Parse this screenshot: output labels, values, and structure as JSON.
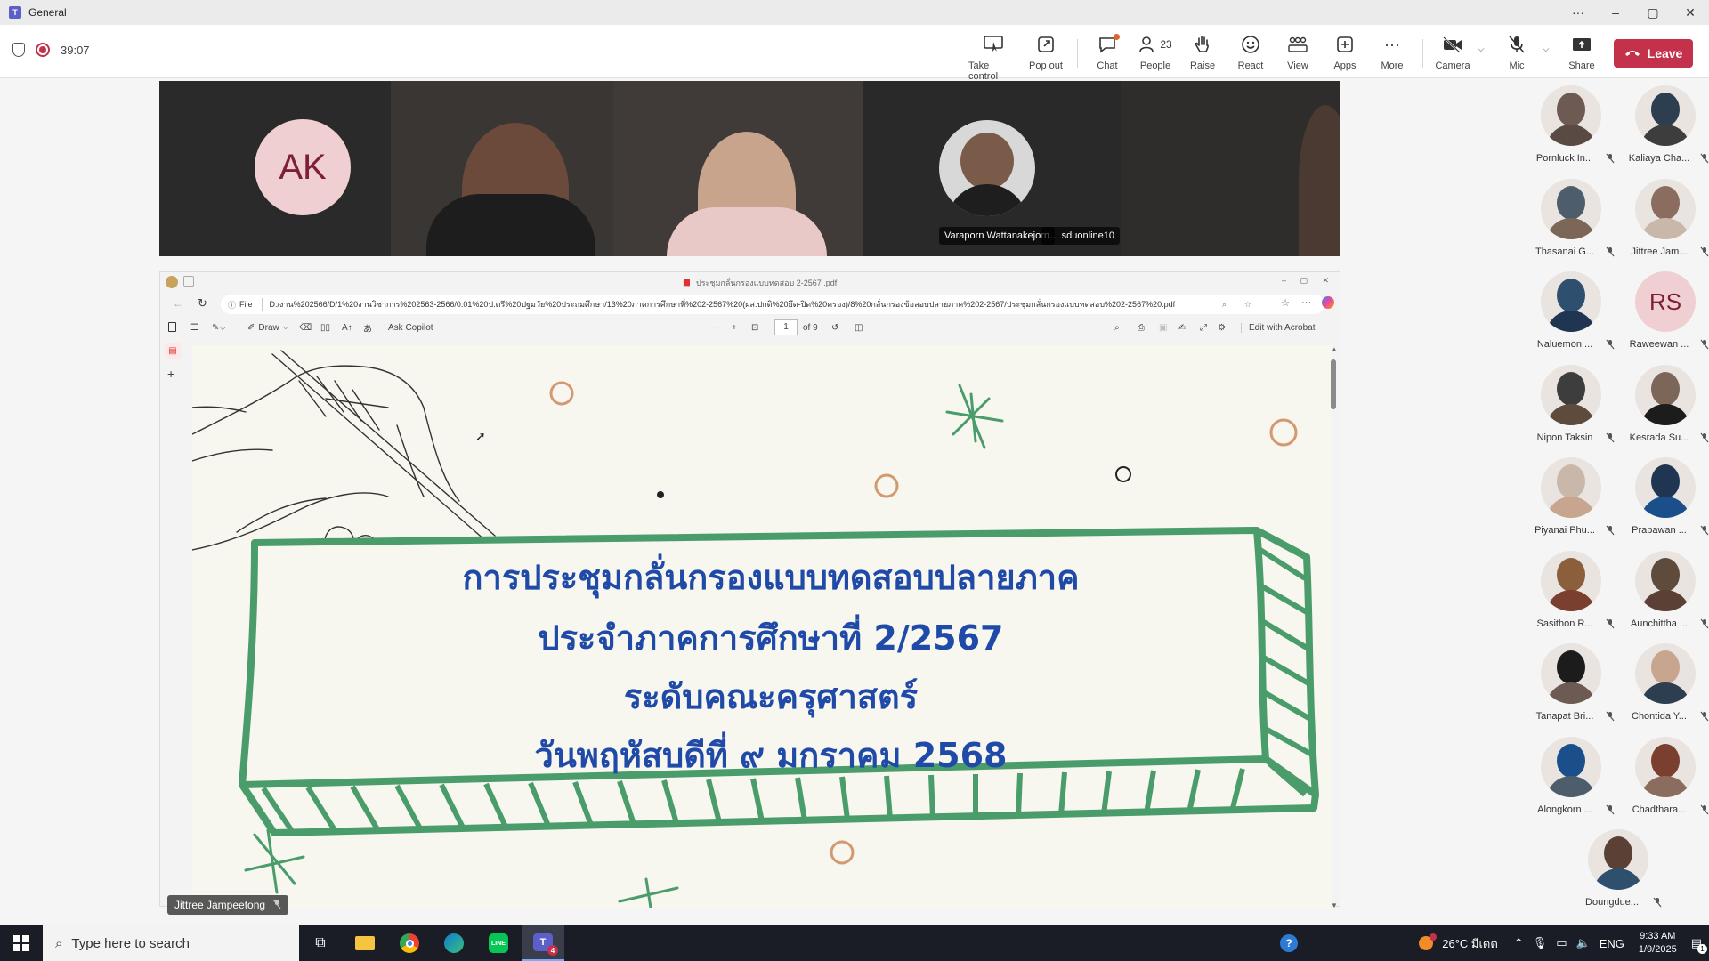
{
  "window": {
    "title": "General"
  },
  "meeting": {
    "timer": "39:07",
    "toolbar": [
      {
        "key": "take-control",
        "label": "Take control",
        "icon": "take-control-icon"
      },
      {
        "key": "pop-out",
        "label": "Pop out",
        "icon": "pop-out-icon"
      },
      {
        "key": "chat",
        "label": "Chat",
        "icon": "chat-icon"
      },
      {
        "key": "people",
        "label": "People",
        "icon": "people-icon",
        "count": "23"
      },
      {
        "key": "raise",
        "label": "Raise",
        "icon": "hand-icon"
      },
      {
        "key": "react",
        "label": "React",
        "icon": "smile-icon"
      },
      {
        "key": "view",
        "label": "View",
        "icon": "view-icon"
      },
      {
        "key": "apps",
        "label": "Apps",
        "icon": "plus-icon"
      },
      {
        "key": "more",
        "label": "More",
        "icon": "more-icon"
      },
      {
        "key": "camera",
        "label": "Camera",
        "icon": "camera-off-icon"
      },
      {
        "key": "mic",
        "label": "Mic",
        "icon": "mic-off-icon"
      },
      {
        "key": "share",
        "label": "Share",
        "icon": "share-icon"
      }
    ],
    "leave_label": "Leave",
    "accent": "#c4314b"
  },
  "video_strip": {
    "tiles": [
      {
        "initials": "AK"
      },
      {
        "name": ""
      },
      {
        "name": ""
      },
      {
        "name": "Varaporn Wattanakejorn"
      },
      {
        "name": "sduonline10"
      }
    ]
  },
  "shared_screen": {
    "presenter": "Jittree Jampeetong",
    "pdf": {
      "tab_title": "ประชุมกลั่นกรองแบบทดสอบ 2-2567 .pdf",
      "file_label": "File",
      "address": "D:/งาน%202566/D/1%20งานวิชาการ%202563-2566/0.01%20ป.ตรี%20ปฐมวัย%20ประถมศึกษา/13%20ภาคการศึกษาที่%202-2567%20(ผส.ปกติ%20ยึด-ปิด%20ครอง)/8%20กลั่นกรองข้อสอบปลายภาค%202-2567/ประชุมกลั่นกรองแบบทดสอบ%202-2567%20.pdf",
      "tools": {
        "draw": "Draw",
        "ask_copilot": "Ask Copilot",
        "page_current": "1",
        "page_total": "of 9",
        "edit_acrobat": "Edit with Acrobat"
      },
      "title_lines": [
        "การประชุมกลั่นกรองแบบทดสอบปลายภาค",
        "ประจำภาคการศึกษาที่ 2/2567",
        "ระดับคณะครุศาสตร์",
        "วันพฤหัสบดีที่ ๙ มกราคม 2568"
      ],
      "title_color": "#1f4aa8",
      "frame_color": "#4a9c6b"
    }
  },
  "participants": [
    {
      "name": "Pornluck In...",
      "type": "photo"
    },
    {
      "name": "Kaliaya Cha...",
      "type": "photo"
    },
    {
      "name": "Thasanai G...",
      "type": "photo"
    },
    {
      "name": "Jittree Jam...",
      "type": "photo"
    },
    {
      "name": "Naluemon ...",
      "type": "photo"
    },
    {
      "name": "Raweewan ...",
      "type": "initials",
      "initials": "RS"
    },
    {
      "name": "Nipon Taksin",
      "type": "photo"
    },
    {
      "name": "Kesrada Su...",
      "type": "photo"
    },
    {
      "name": "Piyanai Phu...",
      "type": "photo"
    },
    {
      "name": "Prapawan ...",
      "type": "photo"
    },
    {
      "name": "Sasithon R...",
      "type": "photo"
    },
    {
      "name": "Aunchittha ...",
      "type": "photo"
    },
    {
      "name": "Tanapat Bri...",
      "type": "photo"
    },
    {
      "name": "Chontida Y...",
      "type": "photo"
    },
    {
      "name": "Alongkorn ...",
      "type": "photo"
    },
    {
      "name": "Chadthara...",
      "type": "photo"
    },
    {
      "name": "Doungdue...",
      "type": "photo"
    }
  ],
  "taskbar": {
    "search_placeholder": "Type here to search",
    "weather": "26°C มีเดต",
    "language": "ENG",
    "time": "9:33 AM",
    "date": "1/9/2025",
    "teams_badge": "4",
    "notification_count": "1"
  }
}
